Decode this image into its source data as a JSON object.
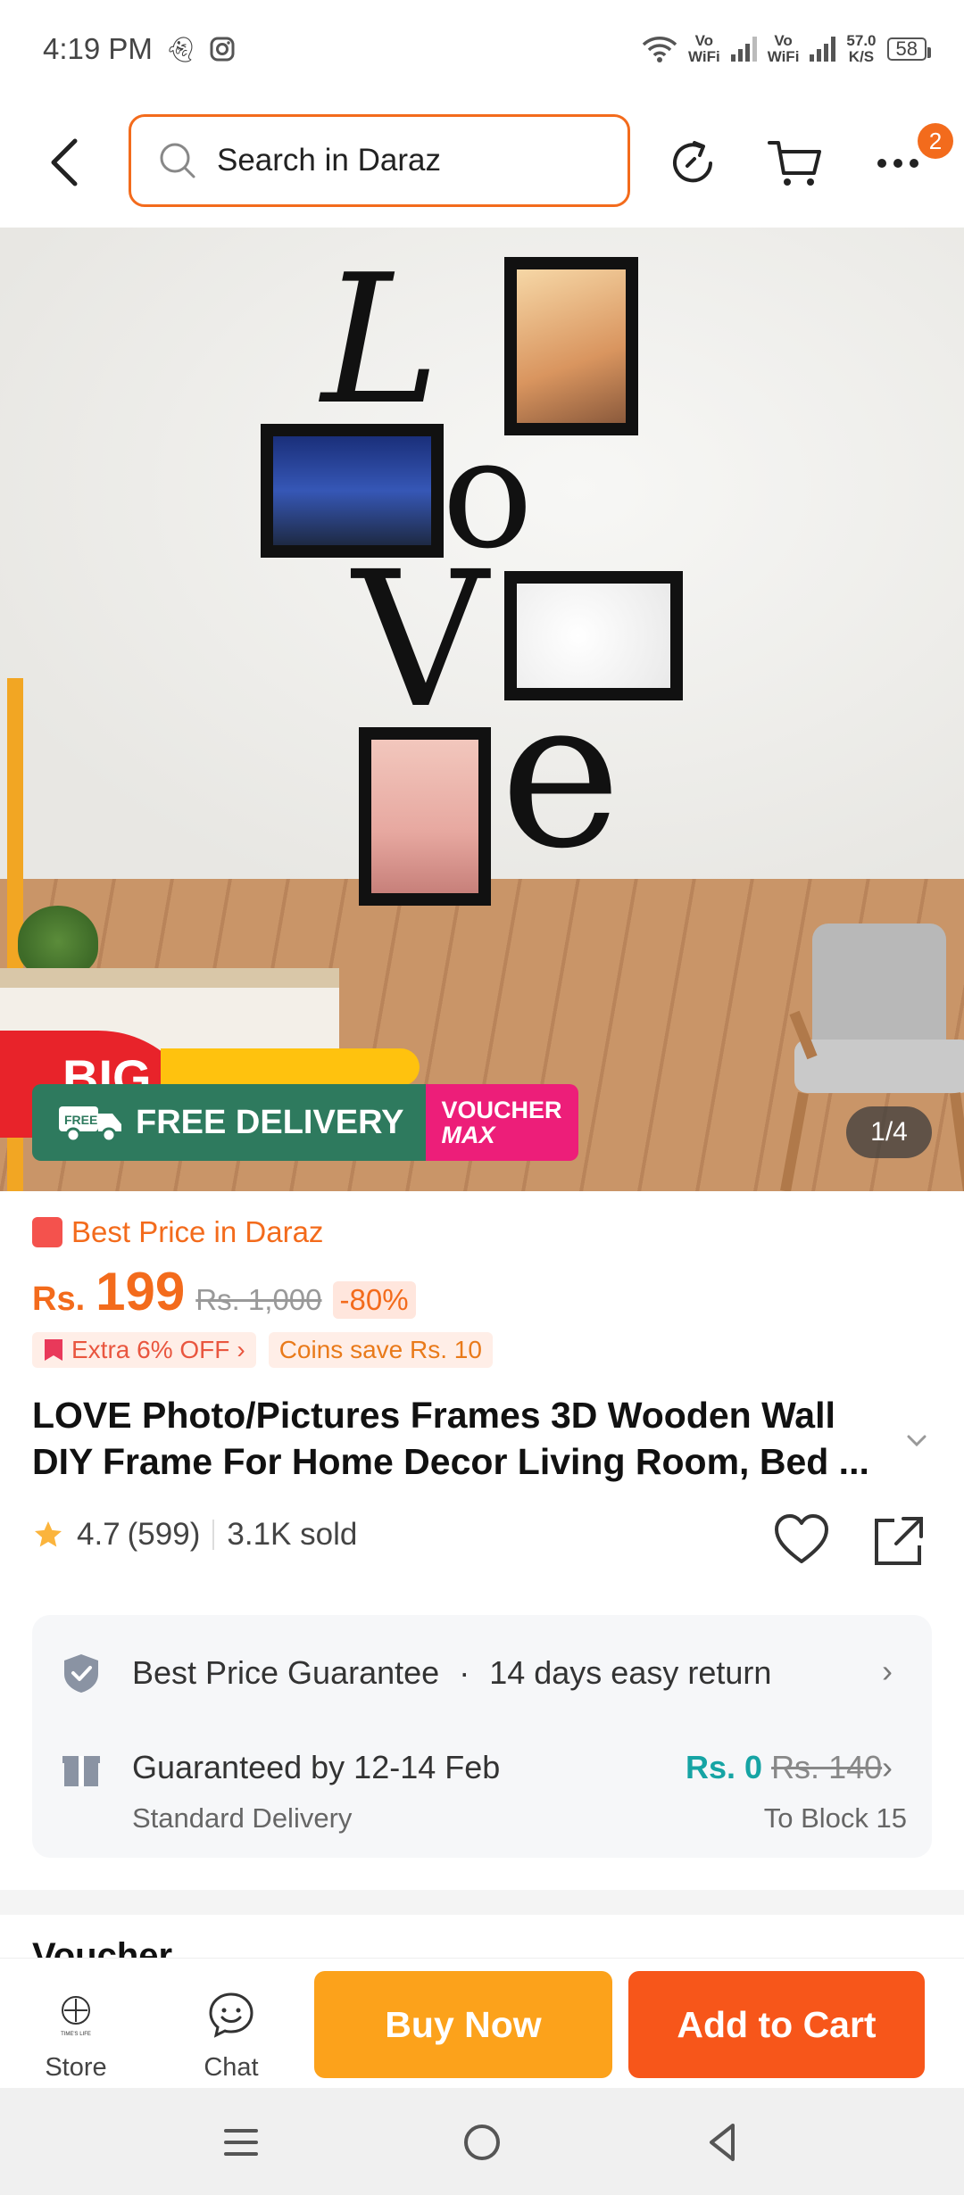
{
  "status_bar": {
    "time": "4:19 PM",
    "net1": "Vo",
    "net1b": "WiFi",
    "net2": "Vo",
    "net2b": "WiFi",
    "speed": "57.0",
    "speed_unit": "K/S",
    "battery": "58"
  },
  "header": {
    "search_placeholder": "Search in Daraz",
    "more_badge": "2"
  },
  "gallery": {
    "counter": "1/4",
    "free_delivery": "FREE DELIVERY",
    "free_tag": "FREE",
    "voucher_top": "VOUCHER",
    "voucher_bottom": "MAX",
    "big_badge": "BIG"
  },
  "product": {
    "best_price_label": "Best Price in Daraz",
    "currency": "Rs.",
    "price": "199",
    "original_price": "Rs. 1,000",
    "discount": "-80%",
    "promo_extra": "Extra 6% OFF",
    "promo_coins": "Coins save Rs. 10",
    "title": "LOVE Photo/Pictures Frames 3D Wooden Wall DIY Frame For Home Decor Living Room, Bed ...",
    "rating": "4.7",
    "rating_count": "(599)",
    "sold": "3.1K sold"
  },
  "services": {
    "guarantee": "Best Price Guarantee",
    "dot": "·",
    "return": "14 days easy return",
    "delivery_title": "Guaranteed by 12-14 Feb",
    "delivery_type": "Standard Delivery",
    "delivery_fee": "Rs. 0",
    "delivery_fee_old": "Rs. 140",
    "destination": "To Block 15"
  },
  "next_section_peek": "Voucher",
  "action_bar": {
    "store_label": "Store",
    "store_logo_text": "TIME'S LIFE",
    "chat_label": "Chat",
    "buy_now": "Buy Now",
    "add_to_cart": "Add to Cart"
  },
  "colors": {
    "brand_orange": "#f36b1c",
    "buy_now": "#fca21b",
    "add_to_cart": "#f7561a",
    "free_delivery": "#2e7a5e",
    "voucher": "#ed1e79",
    "free_fee": "#16a4a4"
  }
}
